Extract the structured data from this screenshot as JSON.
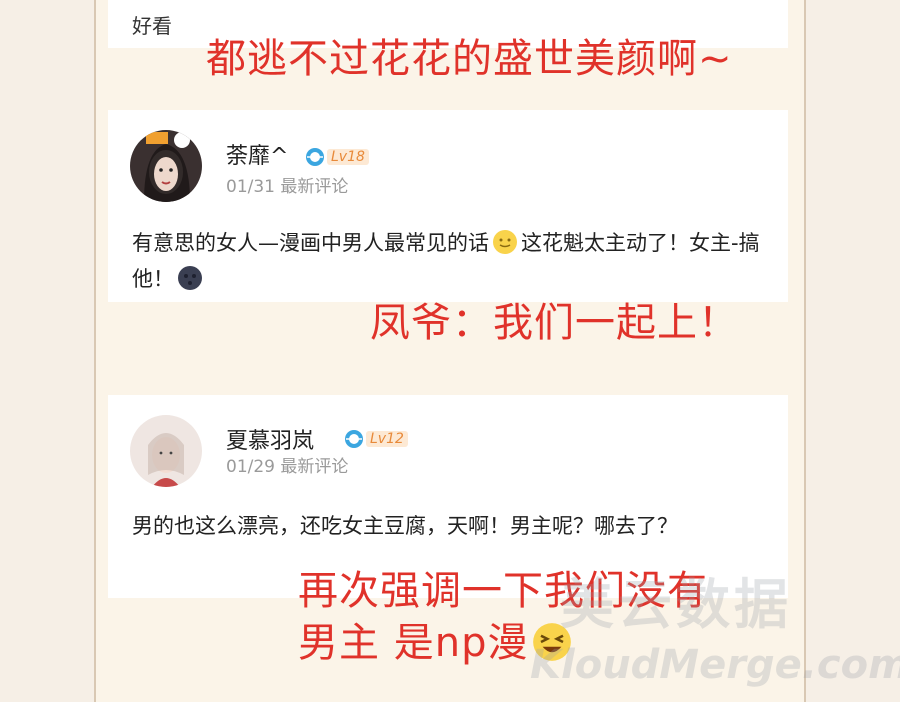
{
  "card_prev": {
    "snippet": "好看"
  },
  "comments": [
    {
      "user": "荼靡^",
      "level": "Lv18",
      "date": "01/31",
      "tag": "最新评论",
      "text_a": "有意思的女人—漫画中男人最常见的话",
      "text_b": "这花魁太主动了！女主-搞他！"
    },
    {
      "user": "夏慕羽岚",
      "level": "Lv12",
      "date": "01/29",
      "tag": "最新评论",
      "text": "男的也这么漂亮，还吃女主豆腐，天啊！男主呢？哪去了？"
    }
  ],
  "annotations": {
    "a1": "都逃不过花花的盛世美颜啊~",
    "a2": "凤爷：我们一起上！",
    "a3_line1": "再次强调一下我们没有",
    "a3_line2": "男主 是np漫"
  },
  "watermark": {
    "top": "美云数据",
    "bottom": "KloudMerge.com"
  },
  "colors": {
    "annotation": "#e0322a",
    "level_badge": "#e88a3a",
    "meta": "#9a9a9a"
  },
  "icons": [
    "globe-level-icon",
    "slight-smile-emoji",
    "new-moon-face-emoji",
    "laughing-emoji"
  ]
}
